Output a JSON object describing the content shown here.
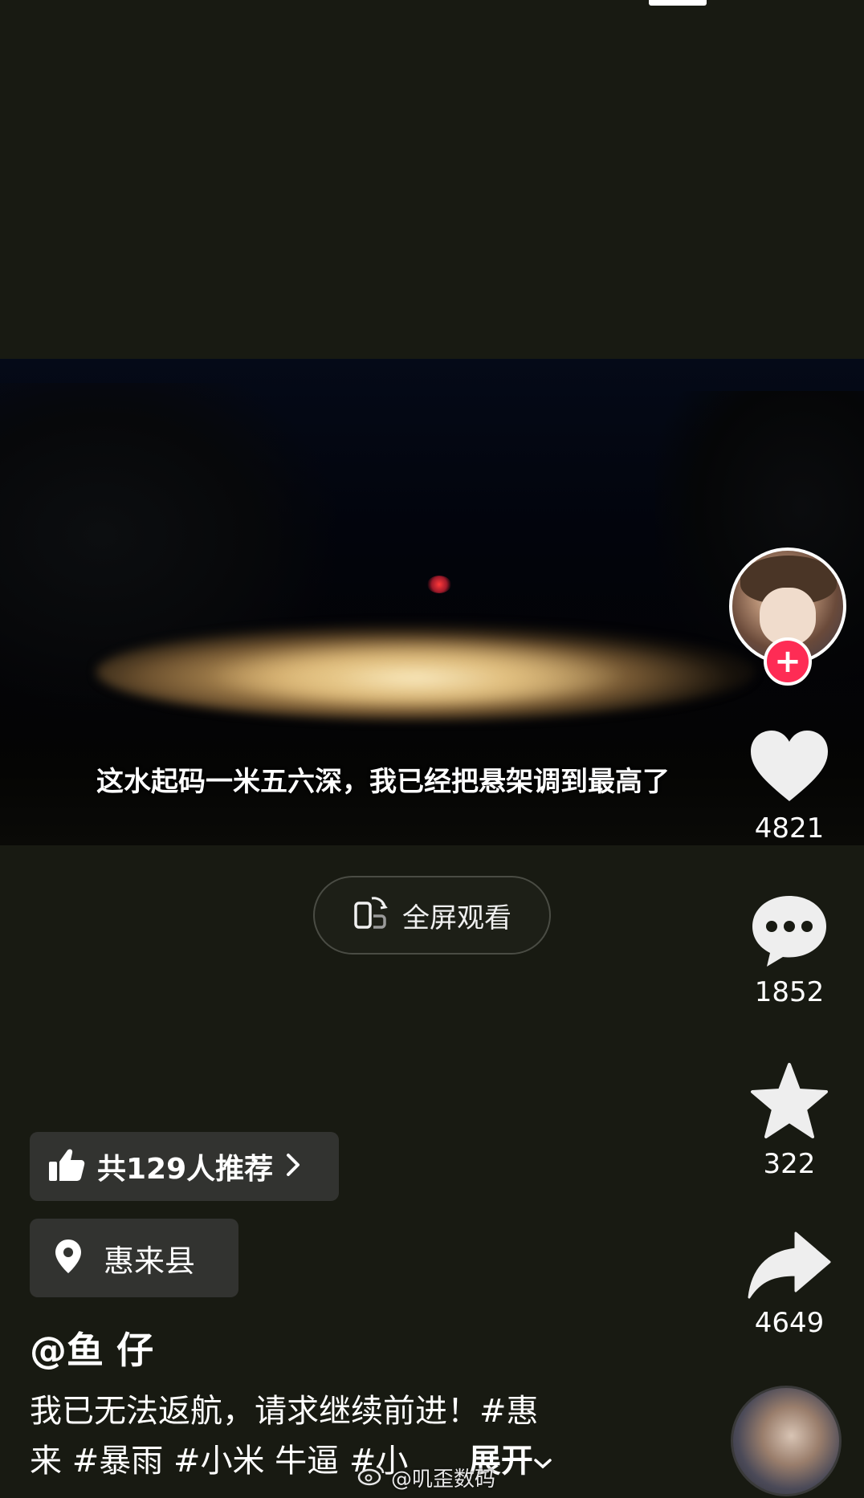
{
  "video": {
    "subtitle": "这水起码一米五六深，我已经把悬架调到最高了"
  },
  "fullscreen": {
    "label": "全屏观看"
  },
  "actions": {
    "like_count": "4821",
    "comment_count": "1852",
    "favorite_count": "322",
    "share_count": "4649"
  },
  "recommend": {
    "label": "共129人推荐"
  },
  "location": {
    "label": "惠来县"
  },
  "author": {
    "name": "@鱼 仔"
  },
  "description": {
    "line1": "我已无法返航，请求继续前进！#惠",
    "line2": "来 #暴雨 #小米 牛逼 #小",
    "more": "展开"
  },
  "watermark": {
    "text": "@叽歪数码"
  },
  "colors": {
    "accent": "#fe2c55",
    "background": "#181a12",
    "chip": "#323330"
  }
}
